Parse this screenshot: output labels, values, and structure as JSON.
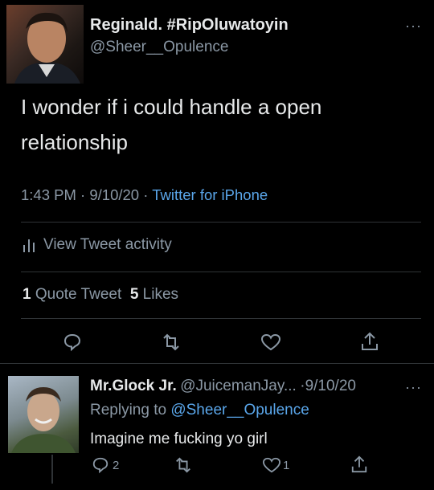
{
  "tweet": {
    "author_name": "Reginald. #RipOluwatoyin",
    "author_handle": "@Sheer__Opulence",
    "more": "···",
    "text_line1": "I wonder if i could handle a open",
    "text_line2": "relationship",
    "time": "1:43 PM",
    "sep1": " · ",
    "date": "9/10/20",
    "sep2": " · ",
    "source": "Twitter for iPhone",
    "activity_label": "View Tweet activity",
    "quote_count": "1",
    "quote_label": "Quote Tweet",
    "like_count": "5",
    "like_label": "Likes",
    "actions": [
      "reply-icon",
      "retweet-icon",
      "heart-icon",
      "share-icon"
    ]
  },
  "reply": {
    "author_name": "Mr.Glock Jr.",
    "author_handle": "@JuicemanJay...",
    "date": "·9/10/20",
    "more": "···",
    "replying_prefix": "Replying to",
    "replying_handle": "@Sheer__Opulence",
    "text": "Imagine me fucking yo girl",
    "reply_count": "2",
    "like_count": "1"
  },
  "colors": {
    "background": "#000000",
    "text": "#e7e9ea",
    "muted": "#8b98a5",
    "link": "#5aa6ea",
    "divider": "#2f3336"
  }
}
